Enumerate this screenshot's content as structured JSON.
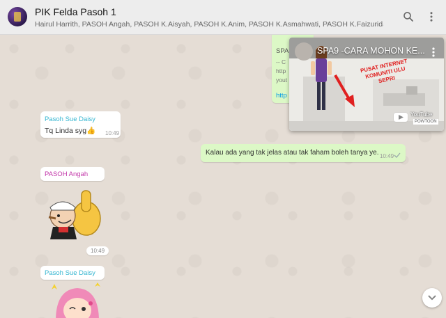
{
  "header": {
    "title": "PIK Felda Pasoh 1",
    "participants": "Hairul Harrith, PASOH Angah, PASOH K.Aisyah, PASOH K.Anim, PASOH K.Asmahwati, PASOH K.Faizuridah, Pasoh Sue Daisy, You",
    "icons": [
      "search-icon",
      "menu-icon"
    ]
  },
  "link_message": {
    "lines": [
      "SPA",
      "-- C",
      "http",
      "yout",
      "http"
    ]
  },
  "video": {
    "title": "SPA9 -CARA MOHON KE...",
    "overlay_text": "PUSAT INTERNET KOMUNITI ULU SEPRI",
    "youtube_label": "YouTube",
    "brand": "POWTOON"
  },
  "messages": [
    {
      "sender": "Pasoh Sue Daisy",
      "text": "Tq Linda syg👍",
      "time": "10:49",
      "sender_color": "#35b6d1"
    },
    {
      "text": "Kalau ada yang tak jelas atau tak faham boleh tanya ye.",
      "time": "10:49"
    },
    {
      "sender": "PASOH Angah",
      "time": "10:49",
      "sender_color": "#c236a9"
    },
    {
      "sender": "Pasoh Sue Daisy",
      "sender_color": "#35b6d1"
    }
  ],
  "colors": {
    "outgoing": "#dcf8c6",
    "incoming": "#ffffff",
    "background": "#e5ddd5",
    "header": "#ededed"
  }
}
